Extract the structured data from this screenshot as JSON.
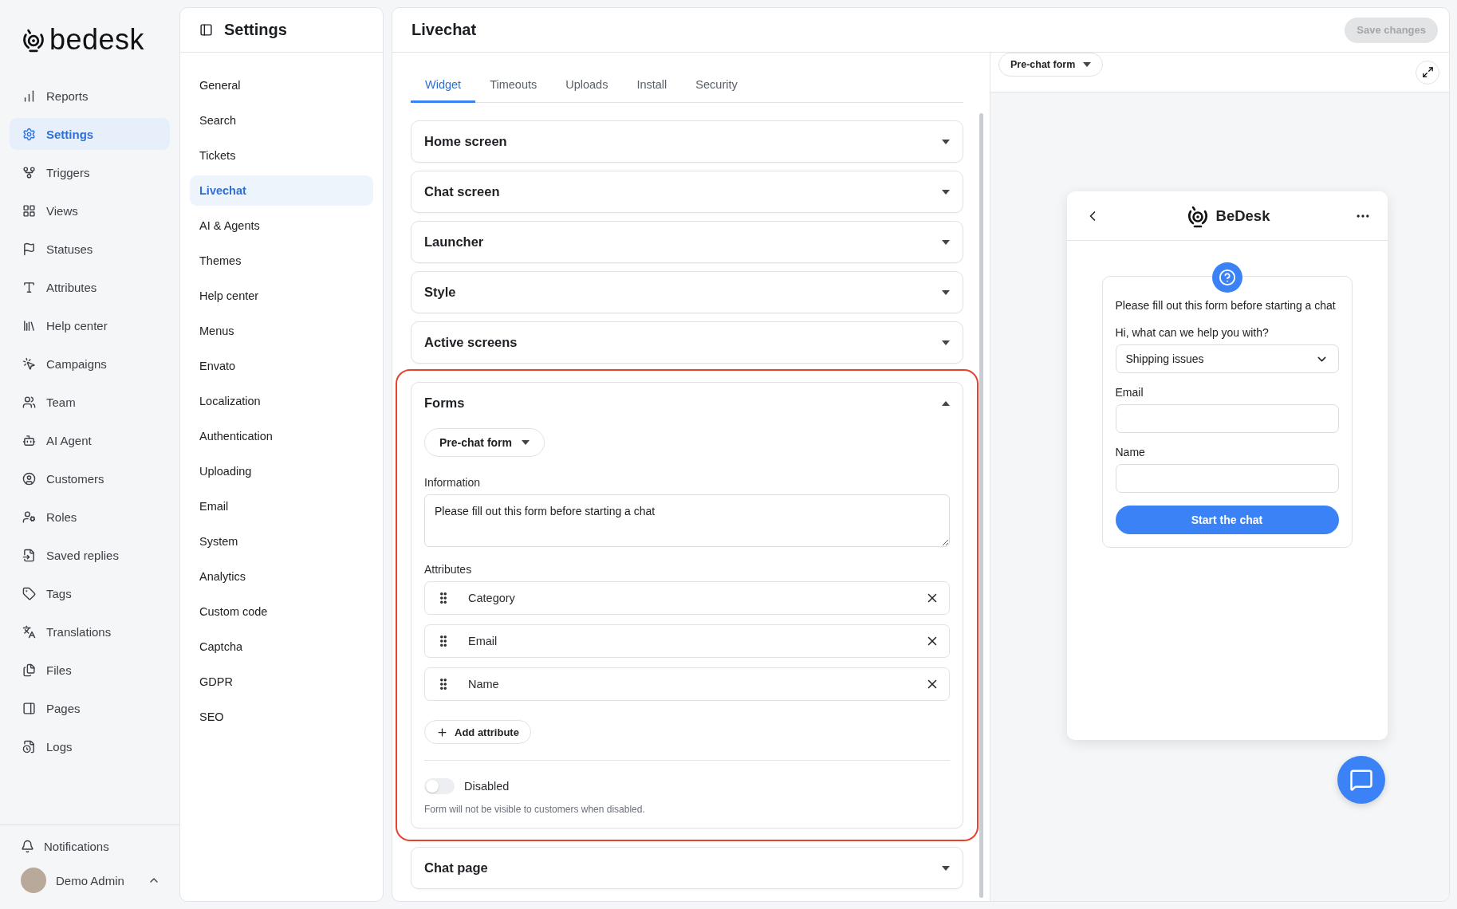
{
  "sidebar": {
    "logo": "bedesk",
    "items": [
      {
        "label": "Reports",
        "selected": false
      },
      {
        "label": "Settings",
        "selected": true
      },
      {
        "label": "Triggers",
        "selected": false
      },
      {
        "label": "Views",
        "selected": false
      },
      {
        "label": "Statuses",
        "selected": false
      },
      {
        "label": "Attributes",
        "selected": false
      },
      {
        "label": "Help center",
        "selected": false
      },
      {
        "label": "Campaigns",
        "selected": false
      },
      {
        "label": "Team",
        "selected": false
      },
      {
        "label": "AI Agent",
        "selected": false
      },
      {
        "label": "Customers",
        "selected": false
      },
      {
        "label": "Roles",
        "selected": false
      },
      {
        "label": "Saved replies",
        "selected": false
      },
      {
        "label": "Tags",
        "selected": false
      },
      {
        "label": "Translations",
        "selected": false
      },
      {
        "label": "Files",
        "selected": false
      },
      {
        "label": "Pages",
        "selected": false
      },
      {
        "label": "Logs",
        "selected": false
      }
    ],
    "notifications": "Notifications",
    "user": {
      "name": "Demo Admin"
    }
  },
  "settings_nav": {
    "title": "Settings",
    "items": [
      {
        "label": "General",
        "selected": false
      },
      {
        "label": "Search",
        "selected": false
      },
      {
        "label": "Tickets",
        "selected": false
      },
      {
        "label": "Livechat",
        "selected": true
      },
      {
        "label": "AI & Agents",
        "selected": false
      },
      {
        "label": "Themes",
        "selected": false
      },
      {
        "label": "Help center",
        "selected": false
      },
      {
        "label": "Menus",
        "selected": false
      },
      {
        "label": "Envato",
        "selected": false
      },
      {
        "label": "Localization",
        "selected": false
      },
      {
        "label": "Authentication",
        "selected": false
      },
      {
        "label": "Uploading",
        "selected": false
      },
      {
        "label": "Email",
        "selected": false
      },
      {
        "label": "System",
        "selected": false
      },
      {
        "label": "Analytics",
        "selected": false
      },
      {
        "label": "Custom code",
        "selected": false
      },
      {
        "label": "Captcha",
        "selected": false
      },
      {
        "label": "GDPR",
        "selected": false
      },
      {
        "label": "SEO",
        "selected": false
      }
    ]
  },
  "page": {
    "title": "Livechat",
    "save_button": {
      "label": "Save changes",
      "disabled": true
    }
  },
  "tabs": [
    {
      "label": "Widget",
      "selected": true
    },
    {
      "label": "Timeouts",
      "selected": false
    },
    {
      "label": "Uploads",
      "selected": false
    },
    {
      "label": "Install",
      "selected": false
    },
    {
      "label": "Security",
      "selected": false
    }
  ],
  "sections": [
    {
      "title": "Home screen",
      "expanded": false,
      "highlighted": false
    },
    {
      "title": "Chat screen",
      "expanded": false,
      "highlighted": false
    },
    {
      "title": "Launcher",
      "expanded": false,
      "highlighted": false
    },
    {
      "title": "Style",
      "expanded": false,
      "highlighted": false
    },
    {
      "title": "Active screens",
      "expanded": false,
      "highlighted": false
    },
    {
      "title": "Forms",
      "expanded": true,
      "highlighted": true
    },
    {
      "title": "Chat page",
      "expanded": false,
      "highlighted": false
    }
  ],
  "forms": {
    "form_select": "Pre-chat form",
    "information_label": "Information",
    "information": "Please fill out this form before starting a chat",
    "attributes_label": "Attributes",
    "attributes": [
      "Category",
      "Email",
      "Name"
    ],
    "add_button": "Add attribute",
    "toggle": {
      "label": "Disabled",
      "on": false
    },
    "hint": "Form will not be visible to customers when disabled."
  },
  "preview": {
    "form_select": "Pre-chat form",
    "widget": {
      "title": "BeDesk",
      "message": "Please fill out this form before starting a chat",
      "fields": [
        {
          "kind": "select",
          "label": "Hi, what can we help you with?",
          "value": "Shipping issues"
        },
        {
          "kind": "input",
          "label": "Email"
        },
        {
          "kind": "input",
          "label": "Name"
        }
      ],
      "submit": "Start the chat"
    }
  }
}
